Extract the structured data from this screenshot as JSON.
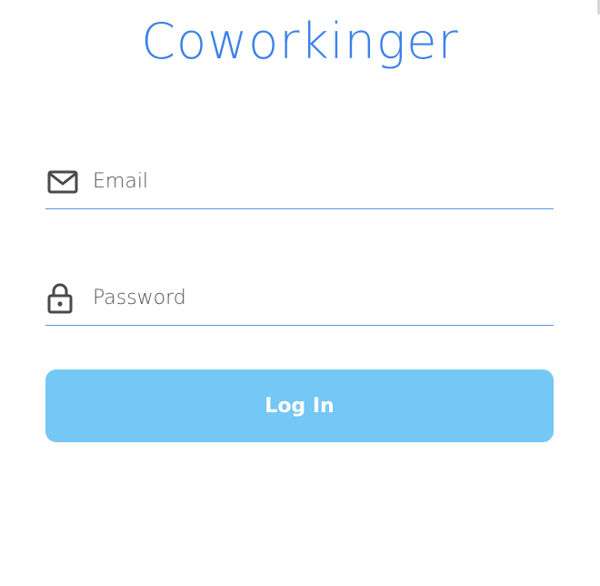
{
  "app": {
    "title": "Coworkinger"
  },
  "form": {
    "email": {
      "placeholder": "Email",
      "value": "",
      "icon": "mail-icon"
    },
    "password": {
      "placeholder": "Password",
      "value": "",
      "icon": "lock-icon"
    },
    "login_label": "Log In"
  },
  "colors": {
    "brand": "#3b82e8",
    "accent_line": "#5a96e6",
    "button_bg": "#75c7f5",
    "icon": "#4a4a4a"
  }
}
